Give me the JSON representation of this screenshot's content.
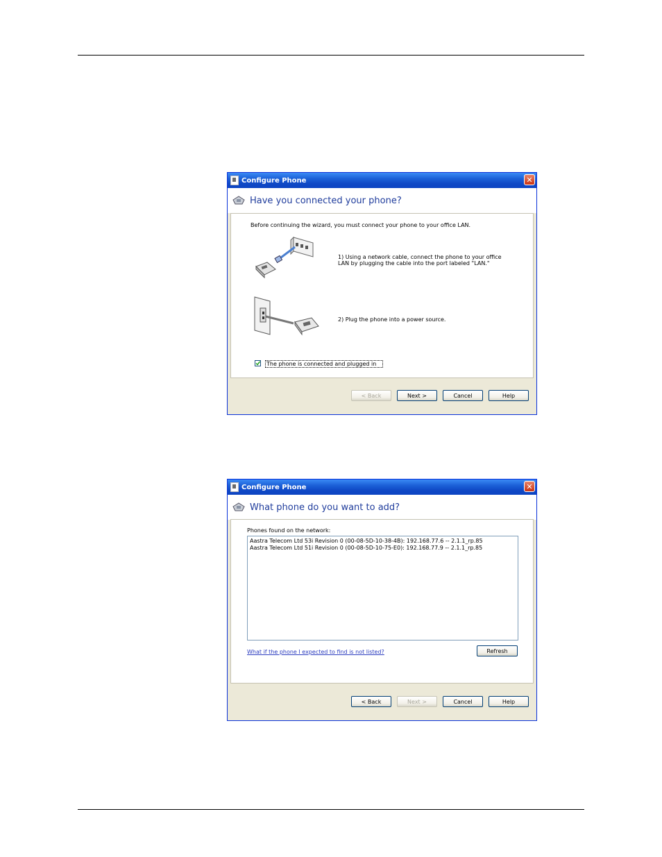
{
  "dialog1": {
    "title": "Configure Phone",
    "close": "✕",
    "heading": "Have you connected your phone?",
    "intro": "Before continuing the wizard, you must connect your phone to your office LAN.",
    "step1_line1": "1) Using a network cable, connect the phone to your office",
    "step1_line2": "LAN by plugging the cable into the port labeled \"LAN.\"",
    "step2": "2) Plug the phone into a power source.",
    "checkbox_label": "The phone is connected and plugged in",
    "checkbox_checked": true,
    "buttons": {
      "back": "< Back",
      "next": "Next >",
      "cancel": "Cancel",
      "help": "Help"
    }
  },
  "dialog2": {
    "title": "Configure Phone",
    "close": "✕",
    "heading": "What phone do you want to add?",
    "list_label": "Phones found on the network:",
    "phones": [
      "Aastra Telecom Ltd 53i Revision 0  (00-08-5D-10-38-4B):  192.168.77.6 -- 2.1.1_rp.85",
      "Aastra Telecom Ltd 51i Revision 0  (00-08-5D-10-75-E0):  192.168.77.9 -- 2.1.1_rp.85"
    ],
    "help_link": "What if the phone I expected to find is not listed?",
    "refresh": "Refresh",
    "buttons": {
      "back": "< Back",
      "next": "Next >",
      "cancel": "Cancel",
      "help": "Help"
    }
  },
  "colors": {
    "title_bar": "#1049c6",
    "heading": "#1f3c9c",
    "dialog_bg": "#ece9d8",
    "link": "#2a3bbf"
  }
}
